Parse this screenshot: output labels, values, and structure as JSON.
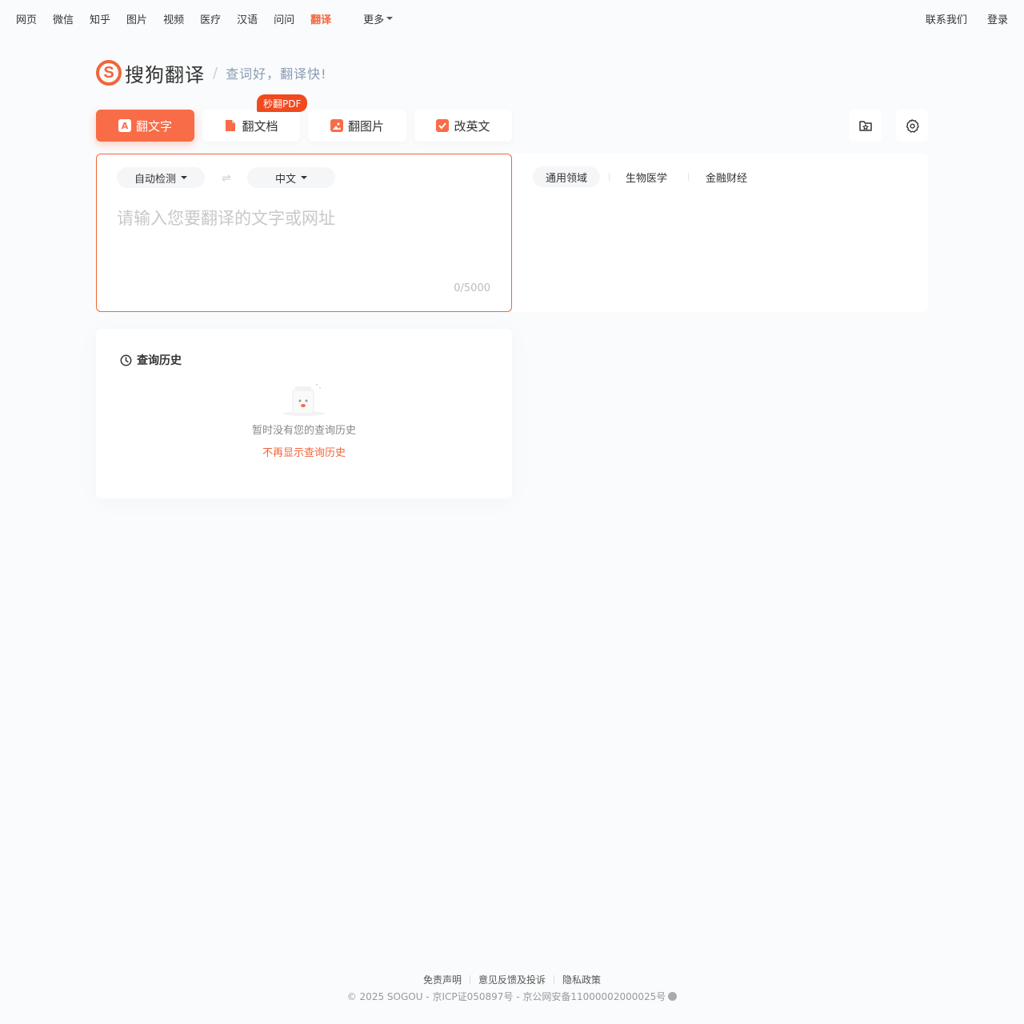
{
  "topnav": {
    "links": [
      "网页",
      "微信",
      "知乎",
      "图片",
      "视频",
      "医疗",
      "汉语",
      "问问",
      "翻译"
    ],
    "more": "更多",
    "contact": "联系我们",
    "login": "登录"
  },
  "logo": {
    "letter": "S",
    "name": "搜狗翻译",
    "separator": "/",
    "slogan": "查词好，翻译快!"
  },
  "tabs": {
    "text": "翻文字",
    "doc": "翻文档",
    "image": "翻图片",
    "english": "改英文",
    "pdf_badge": "秒翻PDF"
  },
  "input": {
    "source_lang": "自动检测",
    "swap": "⇌",
    "target_lang": "中文",
    "placeholder": "请输入您要翻译的文字或网址",
    "value": "",
    "counter": "0/5000"
  },
  "domains": [
    "通用领域",
    "生物医学",
    "金融财经"
  ],
  "history": {
    "title": "查询历史",
    "empty": "暂时没有您的查询历史",
    "hide": "不再显示查询历史"
  },
  "footer": {
    "disclaimer": "免责声明",
    "feedback": "意见反馈及投诉",
    "privacy": "隐私政策",
    "copyright": "© 2025 SOGOU - 京ICP证050897号 - 京公网安备11000002000025号"
  },
  "colors": {
    "accent": "#f2653a",
    "tab_active": "#f86c47"
  }
}
